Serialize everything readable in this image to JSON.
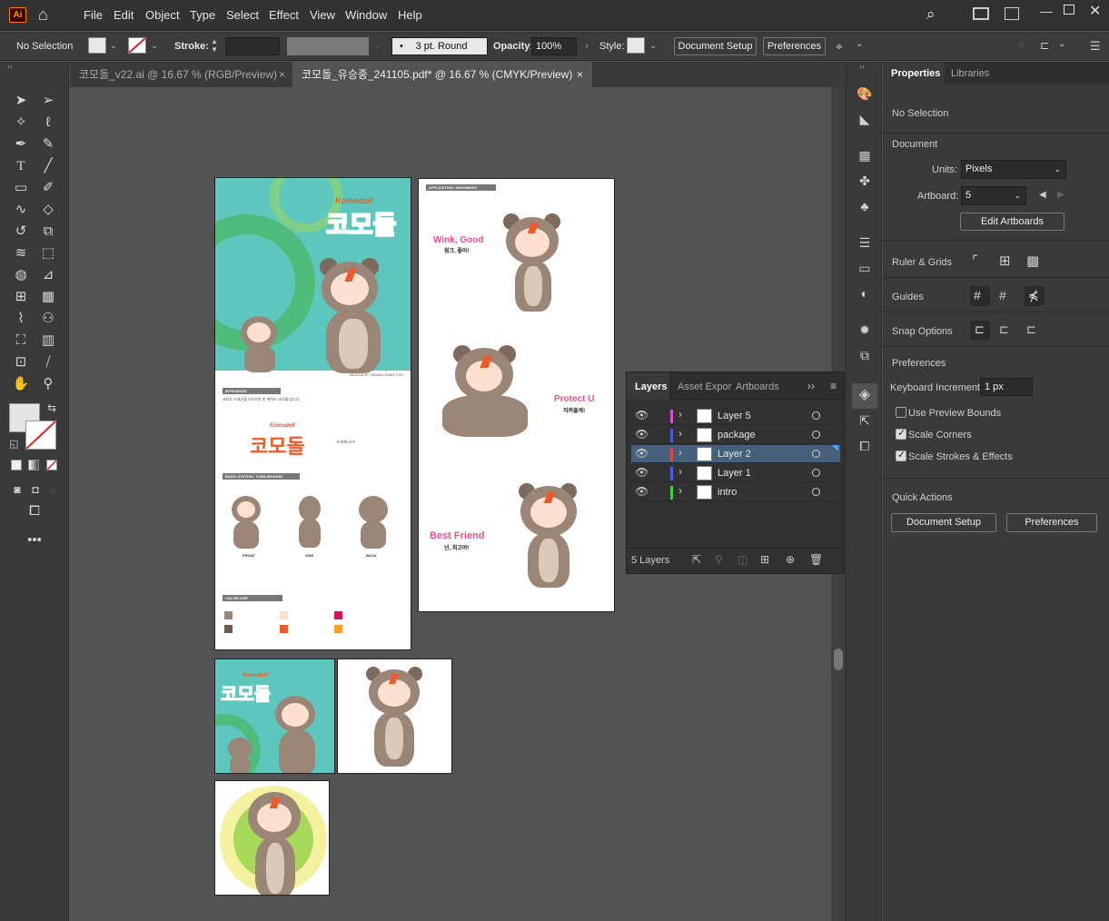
{
  "app": {
    "logo": "Ai"
  },
  "menu": [
    "File",
    "Edit",
    "Object",
    "Type",
    "Select",
    "Effect",
    "View",
    "Window",
    "Help"
  ],
  "control": {
    "selection": "No Selection",
    "stroke_label": "Stroke:",
    "brush": "3 pt. Round",
    "opacity_label": "Opacity:",
    "opacity": "100%",
    "style_label": "Style:",
    "doc_setup": "Document Setup",
    "preferences": "Preferences"
  },
  "tabs": [
    {
      "label": "코모돌_v22.ai @ 16.67 % (RGB/Preview)",
      "close": "×"
    },
    {
      "label": "코모돌_유승종_241105.pdf* @ 16.67 % (CMYK/Preview)",
      "close": "×"
    }
  ],
  "properties": {
    "tab_properties": "Properties",
    "tab_libraries": "Libraries",
    "no_selection": "No Selection",
    "document": "Document",
    "units_label": "Units:",
    "units": "Pixels",
    "artboard_label": "Artboard:",
    "artboard_value": "5",
    "edit_artboards": "Edit Artboards",
    "ruler_grids": "Ruler & Grids",
    "guides": "Guides",
    "snap_options": "Snap Options",
    "preferences": "Preferences",
    "keyboard_increment_label": "Keyboard Increment:",
    "keyboard_increment": "1 px",
    "use_preview_bounds": "Use Preview Bounds",
    "scale_corners": "Scale Corners",
    "scale_strokes": "Scale Strokes & Effects",
    "quick_actions": "Quick Actions",
    "qa_doc_setup": "Document Setup",
    "qa_preferences": "Preferences"
  },
  "layers_panel": {
    "tabs": [
      "Layers",
      "Asset Expor",
      "Artboards"
    ],
    "layers": [
      {
        "name": "Layer 5",
        "color": "#d94bd9"
      },
      {
        "name": "package",
        "color": "#4a5bd9"
      },
      {
        "name": "Layer 2",
        "color": "#e04848"
      },
      {
        "name": "Layer 1",
        "color": "#4a62e0"
      },
      {
        "name": "intro",
        "color": "#3ccf3c"
      }
    ],
    "count": "5 Layers"
  },
  "artwork": {
    "brand_en": "Komodoll",
    "brand_kr": "코모돌",
    "designed_by": "DESIGN BY SEUNG-JONG YOO",
    "introduce": "INTRODUCE",
    "intro_text": "코모도 드래곤을 모티브로 한 캐릭터 '코모돌'입니다.",
    "basic_system": "BASIC SYSTEM / TURN AROUND",
    "views": [
      "FRONT",
      "SIDE",
      "BACK"
    ],
    "color_chip": "COLOR CHIP",
    "application": "APPLICATION / MOVEMENT",
    "wink": "Wink, Good",
    "wink_kr": "윙크, 좋아!",
    "protect": "Protect U",
    "protect_kr": "지켜줄게!",
    "best": "Best Friend",
    "best_kr": "넌, 최고야!",
    "logo_note": "버개체 OFF"
  }
}
